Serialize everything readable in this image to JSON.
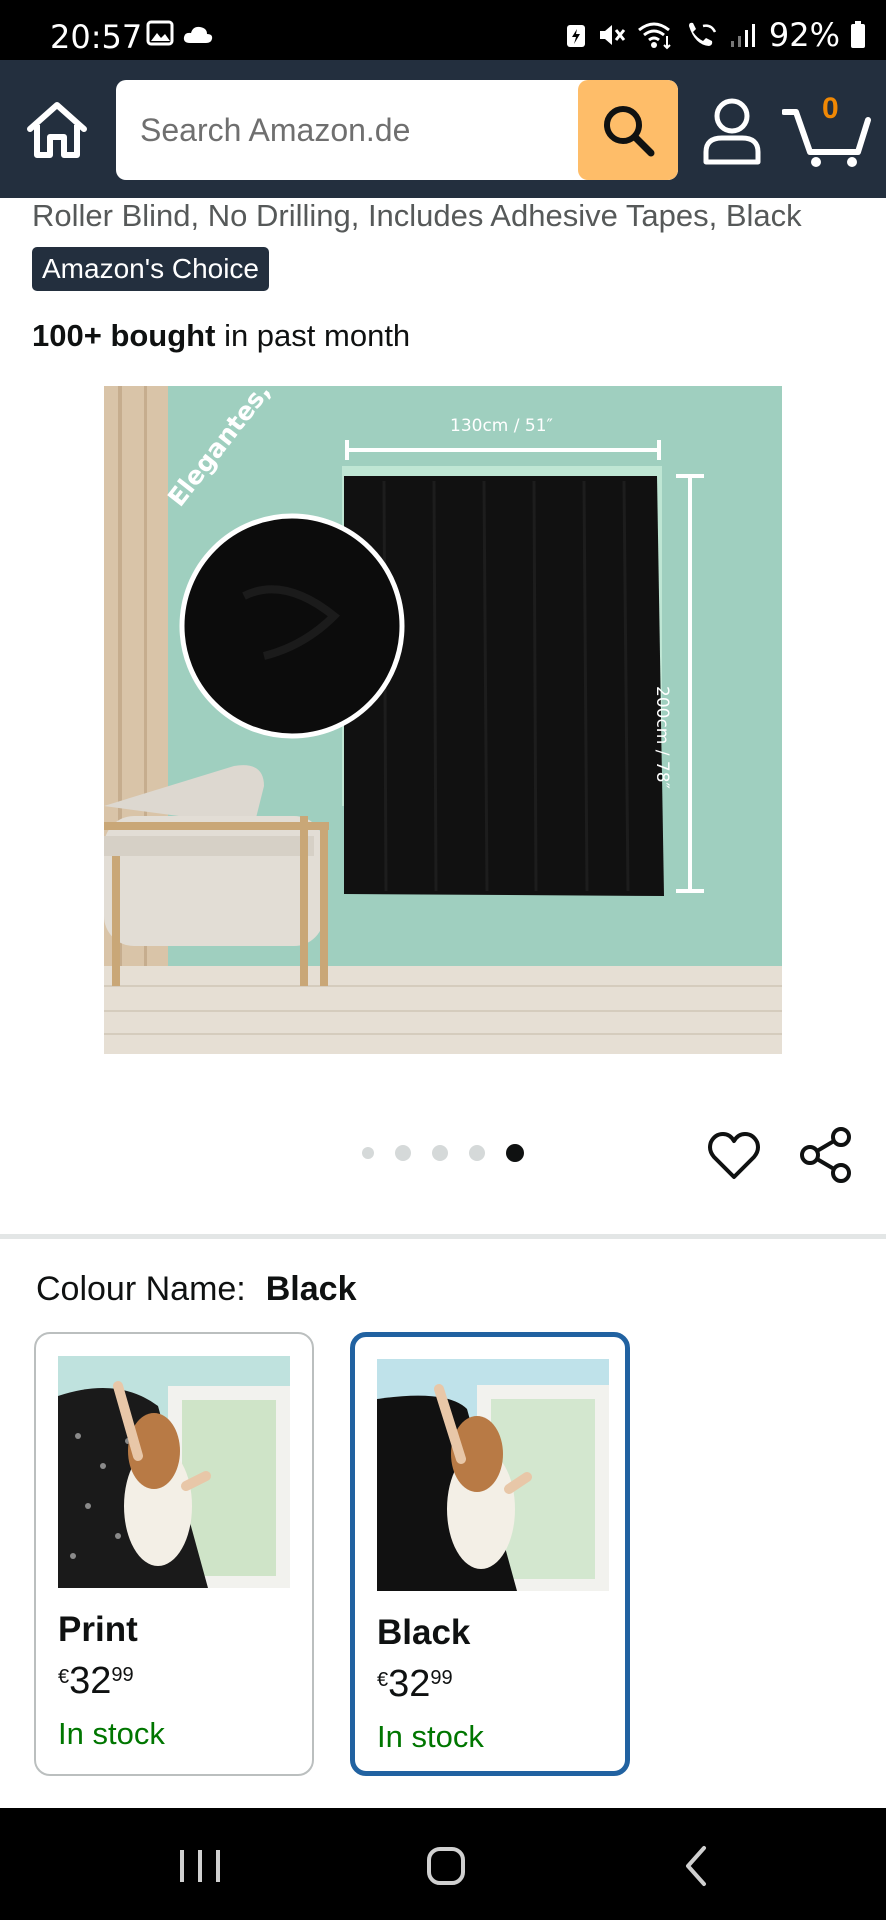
{
  "status_bar": {
    "time": "20:57",
    "battery": "92%",
    "icons": [
      "gallery-icon",
      "cloud-icon",
      "battery-saver-icon",
      "mute-icon",
      "wifi-icon",
      "wifi-call-icon",
      "signal-icon",
      "battery-icon"
    ]
  },
  "header": {
    "search_placeholder": "Search Amazon.de",
    "cart_count": "0"
  },
  "product": {
    "title_fragment": "Roller Blind, No Drilling, Includes Adhesive Tapes, Black",
    "badge": "Amazon's Choice",
    "bought_bold": "100+ bought",
    "bought_rest": " in past month",
    "image": {
      "width_label": "130cm / 51″",
      "height_label": "200cm / 78″",
      "curved_text": "Elegantes, schwarzes Design"
    },
    "image_count": 5,
    "active_image_index": 4
  },
  "colour": {
    "label": "Colour Name:",
    "selected": "Black",
    "options": [
      {
        "name": "Print",
        "currency": "€",
        "price_whole": "32",
        "price_cents": "99",
        "stock": "In stock"
      },
      {
        "name": "Black",
        "currency": "€",
        "price_whole": "32",
        "price_cents": "99",
        "stock": "In stock"
      }
    ]
  },
  "colors": {
    "header_bg": "#232f3e",
    "search_button": "#febd69",
    "cart_count": "#f08804",
    "stock_green": "#007600",
    "selected_border": "#2162a1",
    "wall": "#9fcfbf"
  }
}
